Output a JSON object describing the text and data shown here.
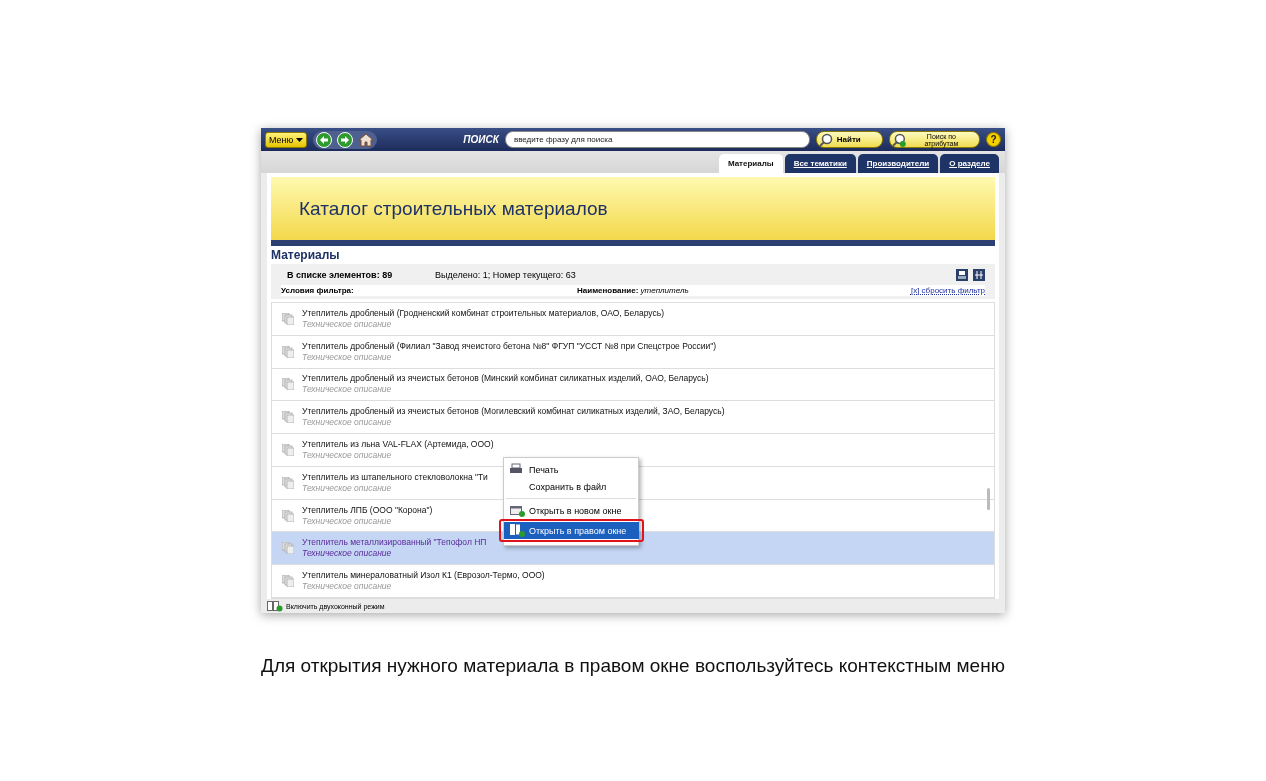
{
  "toolbar": {
    "menu_button": "Меню",
    "search_label": "ПОИСК",
    "search": {
      "placeholder": "введите фразу для поиска"
    },
    "find_button": "Найти",
    "attribute_search_button": "Поиск по атрибутам",
    "help_button": "?"
  },
  "tabs": [
    {
      "label": "Материалы",
      "selected": true
    },
    {
      "label": "Все тематики",
      "selected": false
    },
    {
      "label": "Производители",
      "selected": false
    },
    {
      "label": "О разделе",
      "selected": false
    }
  ],
  "banner": {
    "title": "Каталог строительных материалов"
  },
  "section_title": "Материалы",
  "info": {
    "count": "В списке элементов: 89",
    "selection": "Выделено: 1; Номер текущего: 63",
    "filter_label": "Условия фильтра:",
    "filter_value": "**Наименование:** *утеплитель*",
    "reset_link": "[x] сбросить фильтр"
  },
  "rows": [
    {
      "title": "Утеплитель дробленый (Гродненский комбинат строительных материалов, ОАО, Беларусь)",
      "subtitle": "Техническое описание",
      "selected": false
    },
    {
      "title": "Утеплитель дробленый (Филиал \"Завод ячеистого бетона №8\" ФГУП \"УССТ №8 при Спецстрое России\")",
      "subtitle": "Техническое описание",
      "selected": false
    },
    {
      "title": "Утеплитель дробленый из ячеистых бетонов (Минский комбинат силикатных изделий, ОАО, Беларусь)",
      "subtitle": "Техническое описание",
      "selected": false
    },
    {
      "title": "Утеплитель дробленый из ячеистых бетонов (Могилевский комбинат силикатных изделий, ЗАО, Беларусь)",
      "subtitle": "Техническое описание",
      "selected": false
    },
    {
      "title": "Утеплитель из льна VAL-FLAX (Артемида, ООО)",
      "subtitle": "Техническое описание",
      "selected": false
    },
    {
      "title": "Утеплитель из штапельного стекловолокна \"Ти",
      "subtitle": "Техническое описание",
      "selected": false
    },
    {
      "title": "Утеплитель ЛПБ (ООО \"Корона\")",
      "subtitle": "Техническое описание",
      "selected": false
    },
    {
      "title": "Утеплитель металлизированный \"Тепофол НП",
      "subtitle": "Техническое описание",
      "selected": true
    },
    {
      "title": "Утеплитель минераловатный Изол К1 (Еврозол-Термо, ООО)",
      "subtitle": "Техническое описание",
      "selected": false
    }
  ],
  "context_menu": [
    {
      "kind": "print",
      "label": "Печать",
      "selected": false
    },
    {
      "kind": "plain",
      "label": "Сохранить в файл",
      "selected": false
    },
    {
      "kind": "separator"
    },
    {
      "kind": "new-window",
      "label": "Открыть в новом окне",
      "selected": false
    },
    {
      "kind": "right-window",
      "label": "Открыть в правом окне",
      "selected": true
    }
  ],
  "status_bar": {
    "label": "Включить двухоконный режим"
  },
  "caption": "Для открытия нужного материала в правом окне воспользуйтесь контекстным меню"
}
